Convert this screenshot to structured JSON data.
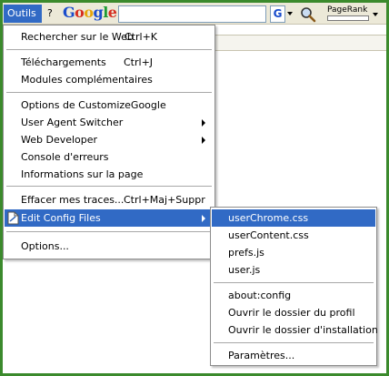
{
  "toolbar": {
    "outils_menu": "Outils",
    "help_menu": "?",
    "google_letters": [
      "G",
      "o",
      "o",
      "g",
      "l",
      "e"
    ],
    "g_button": "G",
    "pagerank_label": "PageRank",
    "pagerank_fill": 0
  },
  "main_menu": [
    {
      "label": "Rechercher sur le Web",
      "shortcut": "Ctrl+K"
    },
    {
      "label": "Téléchargements",
      "shortcut": "Ctrl+J"
    },
    {
      "label": "Modules complémentaires"
    },
    {
      "label": "Options de CustomizeGoogle"
    },
    {
      "label": "User Agent Switcher",
      "submenu": true
    },
    {
      "label": "Web Developer",
      "submenu": true
    },
    {
      "label": "Console d'erreurs"
    },
    {
      "label": "Informations sur la page"
    },
    {
      "label": "Effacer mes traces...",
      "shortcut": "Ctrl+Maj+Suppr"
    },
    {
      "label": "Edit Config Files",
      "submenu": true,
      "highlighted": true
    },
    {
      "label": "Options..."
    }
  ],
  "sub_menu": [
    {
      "label": "userChrome.css",
      "highlighted": true
    },
    {
      "label": "userContent.css"
    },
    {
      "label": "prefs.js"
    },
    {
      "label": "user.js"
    },
    {
      "label": "about:config"
    },
    {
      "label": "Ouvrir le dossier du profil"
    },
    {
      "label": "Ouvrir le dossier d'installation"
    },
    {
      "label": "Paramètres..."
    }
  ],
  "colors": {
    "highlight": "#316ac5",
    "frame": "#3b8a2c"
  },
  "icons": {
    "search": "magnifier-icon",
    "submenu": "chevron-right-icon",
    "config": "document-icon"
  }
}
